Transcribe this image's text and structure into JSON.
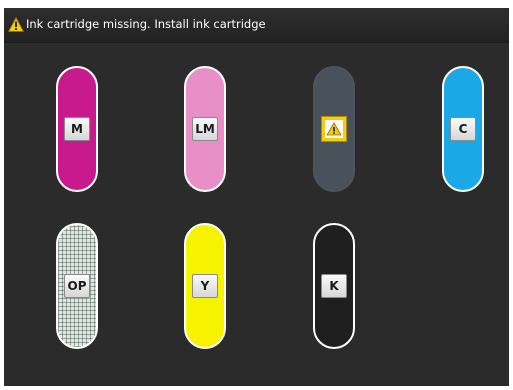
{
  "status_bar": {
    "message": "Ink cartridge missing. Install ink cartridge",
    "icon": "warning-icon"
  },
  "cartridges": [
    {
      "id": "magenta",
      "label": "M",
      "color": "#c81a8c",
      "state": "installed"
    },
    {
      "id": "light-magenta",
      "label": "LM",
      "color": "#e98fc8",
      "state": "installed"
    },
    {
      "id": "missing",
      "label": "",
      "color": "#49525a",
      "state": "missing",
      "icon": "warning-icon"
    },
    {
      "id": "cyan",
      "label": "C",
      "color": "#1aa8e6",
      "state": "installed"
    },
    {
      "id": "optimizer",
      "label": "OP",
      "color": "#e2e6e3",
      "state": "installed"
    },
    {
      "id": "yellow",
      "label": "Y",
      "color": "#f6f200",
      "state": "installed"
    },
    {
      "id": "black",
      "label": "K",
      "color": "#1f1f1f",
      "state": "installed"
    }
  ],
  "colors": {
    "screen_background": "#2b2b2b",
    "warning_yellow": "#f6cc10"
  }
}
